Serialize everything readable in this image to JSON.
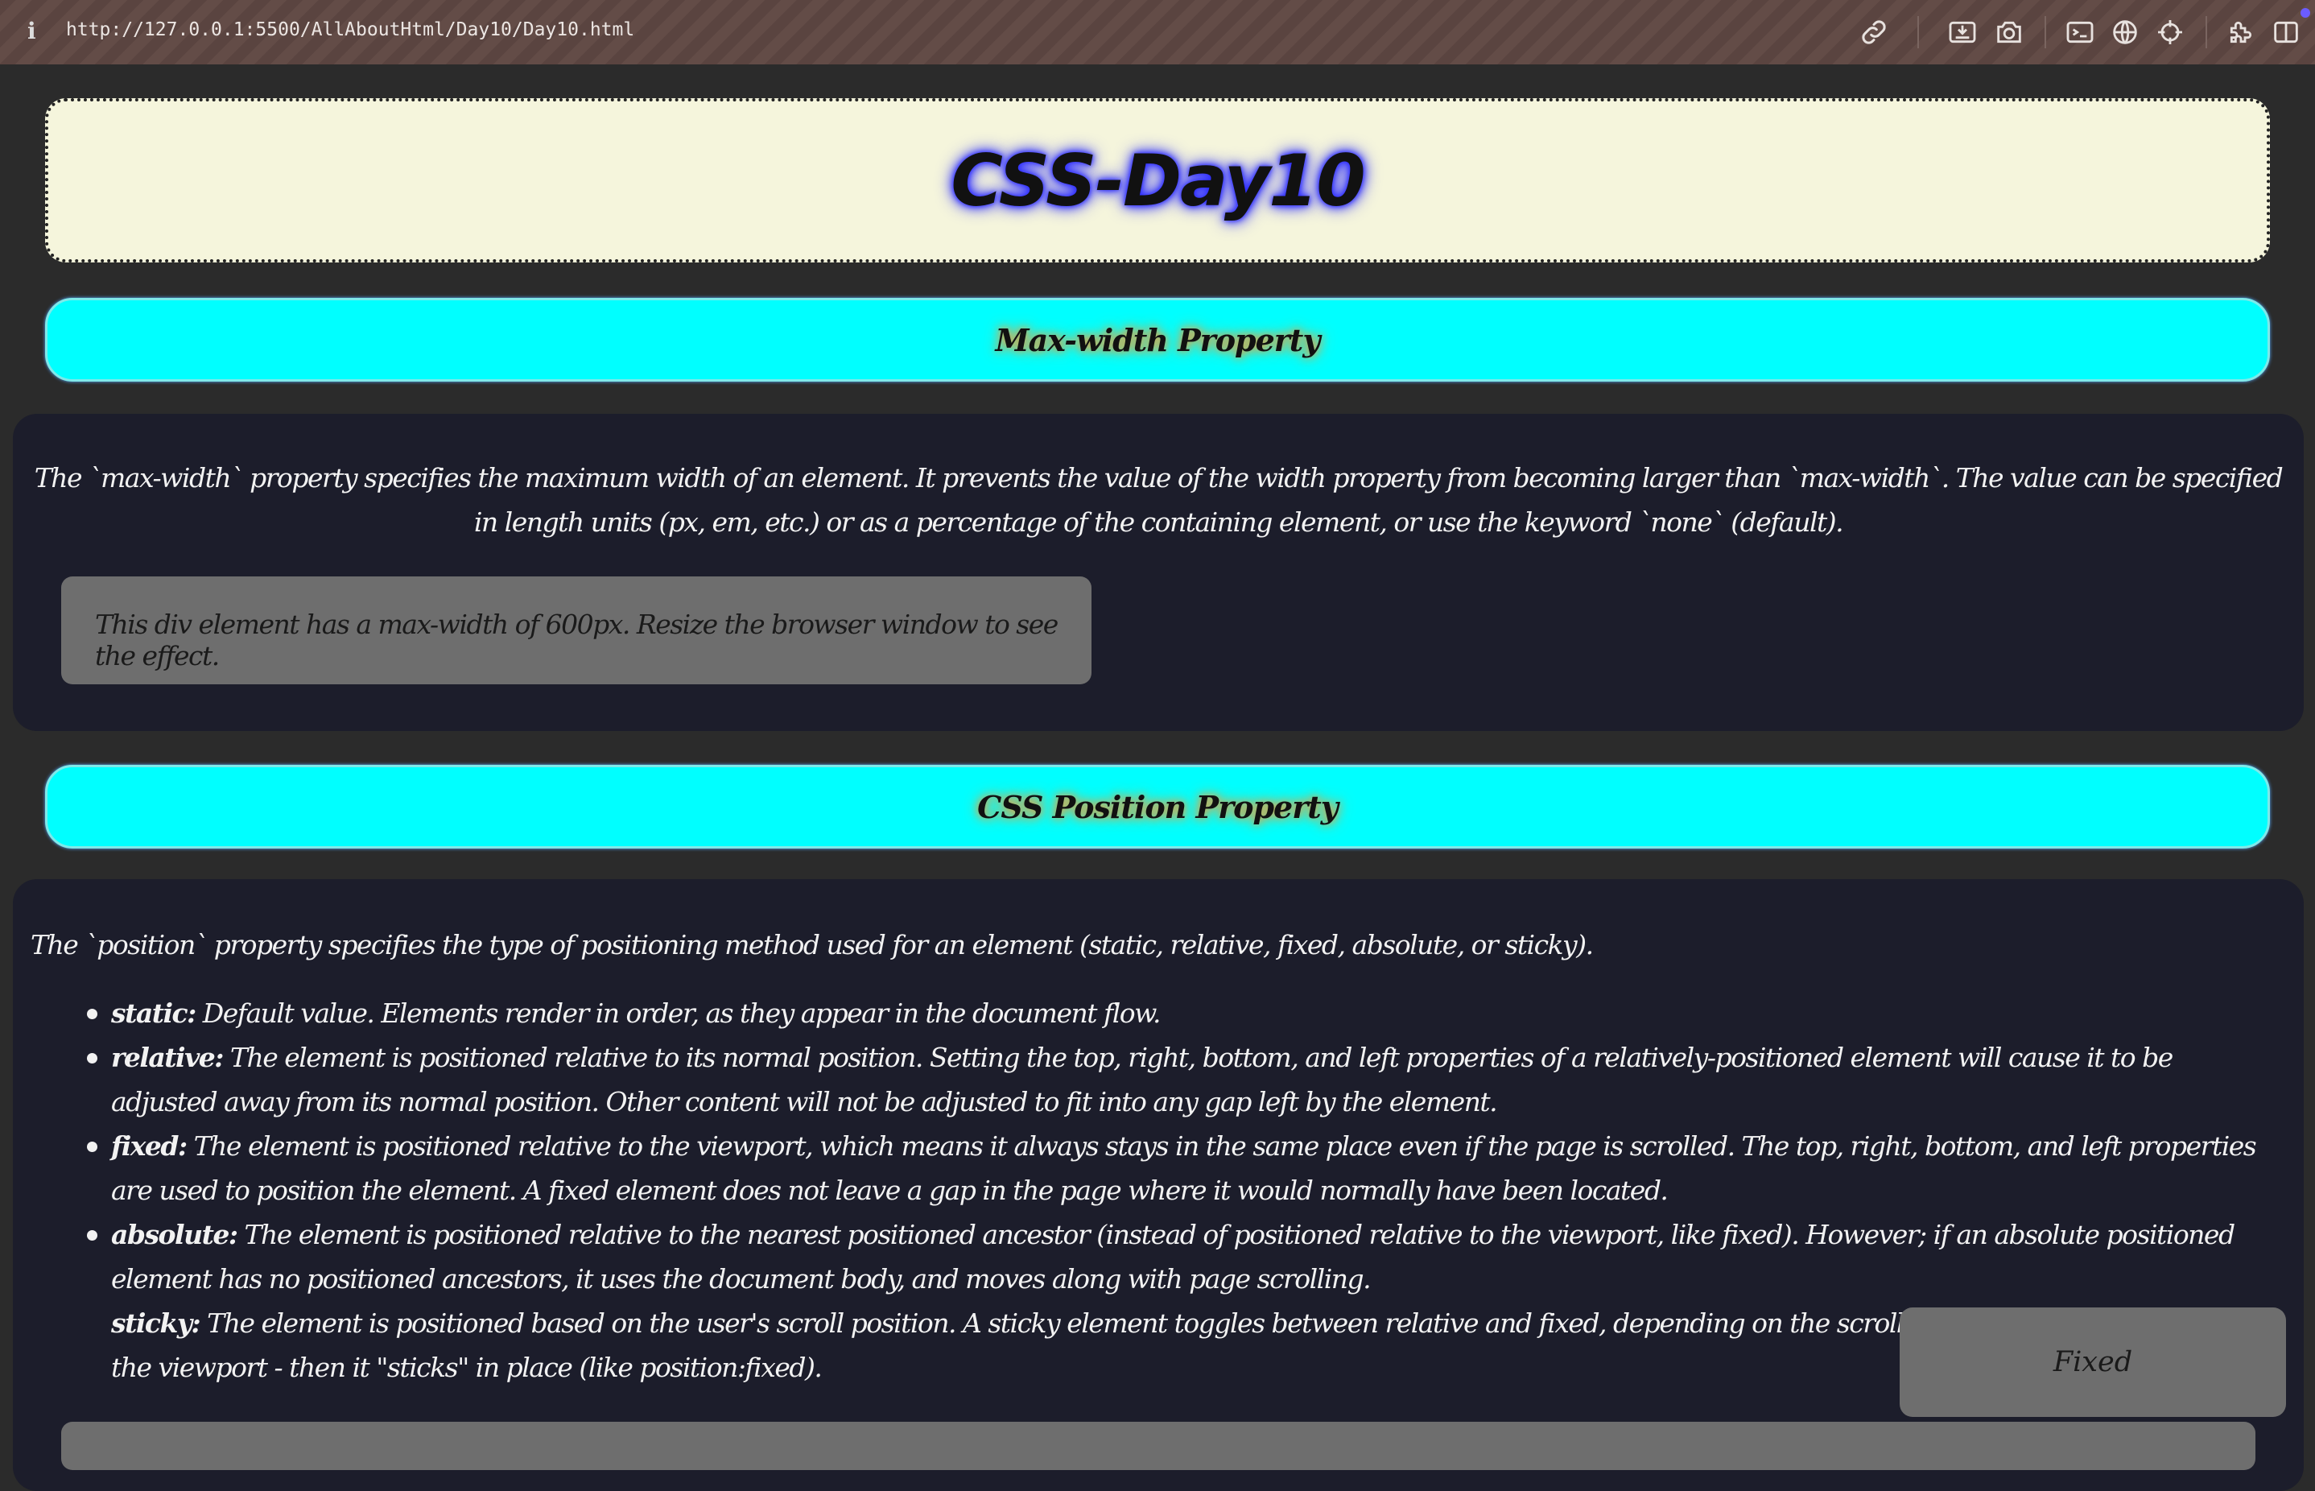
{
  "browser": {
    "url": "http://127.0.0.1:5500/AllAboutHtml/Day10/Day10.html",
    "info_glyph": "i",
    "icons": [
      "link-icon",
      "screenshot-area-icon",
      "camera-icon",
      "terminal-icon",
      "globe-icon",
      "crosshair-icon",
      "extensions-icon",
      "sidebar-icon"
    ]
  },
  "page": {
    "title": "CSS-Day10"
  },
  "maxwidth_section": {
    "heading": "Max-width Property",
    "description": "The `max-width` property specifies the maximum width of an element. It prevents the value of the width property from becoming larger than `max-width`. The value can be specified in length units (px, em, etc.) or as a percentage of the containing element, or use the keyword `none` (default).",
    "demo_text": "This div element has a max-width of 600px. Resize the browser window to see the effect."
  },
  "position_section": {
    "heading": "CSS Position Property",
    "intro": "The `position` property specifies the type of positioning method used for an element (static, relative, fixed, absolute, or sticky).",
    "items": [
      {
        "term": "static:",
        "text": " Default value. Elements render in order, as they appear in the document flow."
      },
      {
        "term": "relative:",
        "text": " The element is positioned relative to its normal position. Setting the top, right, bottom, and left properties of a relatively-positioned element will cause it to be adjusted away from its normal position. Other content will not be adjusted to fit into any gap left by the element."
      },
      {
        "term": "fixed:",
        "text": " The element is positioned relative to the viewport, which means it always stays in the same place even if the page is scrolled. The top, right, bottom, and left properties are used to position the element. A fixed element does not leave a gap in the page where it would normally have been located."
      },
      {
        "term": "absolute:",
        "text": " The element is positioned relative to the nearest positioned ancestor (instead of positioned relative to the viewport, like fixed). However; if an absolute positioned element has no positioned ancestors, it uses the document body, and moves along with page scrolling."
      },
      {
        "term": "sticky:",
        "text": " The element is positioned based on the user's scroll position. A sticky element toggles between relative and fixed, depending on the scroll position. It is positioned relative u"
      },
      {
        "term": "",
        "text": "the viewport - then it \"sticks\" in place (like position:fixed)."
      }
    ],
    "fixed_box_label": "Fixed"
  },
  "colors": {
    "title_bg": "#f5f5dc",
    "heading_bg": "#00ffff",
    "panel_bg": "#1c1d2b",
    "demo_bg": "#6e6e6e",
    "page_bg": "#2b2b2b"
  }
}
